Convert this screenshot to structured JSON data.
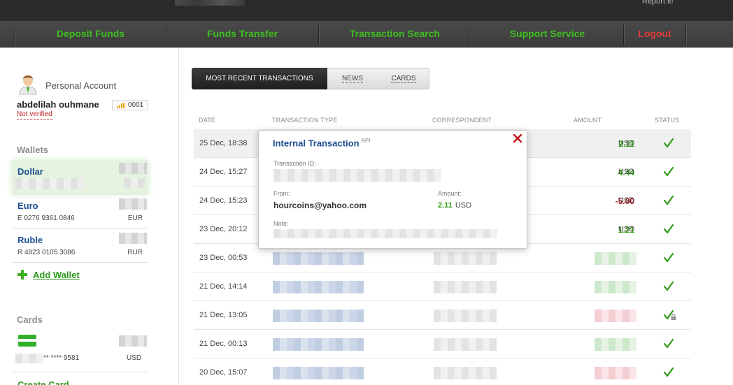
{
  "topbar": {
    "report_link": "Report it!"
  },
  "nav": {
    "items": [
      "Deposit Funds",
      "Funds Transfer",
      "Transaction Search",
      "Support Service"
    ],
    "logout": "Logout"
  },
  "account": {
    "label": "Personal Account",
    "name": "abdelilah ouhmane",
    "badge": "0001",
    "status": "Not verified"
  },
  "wallets": {
    "title": "Wallets",
    "items": [
      {
        "name": "Dollar",
        "number": "",
        "currency": ""
      },
      {
        "name": "Euro",
        "number": "E 0276 9361 0846",
        "currency": "EUR"
      },
      {
        "name": "Ruble",
        "number": "R 4823 0105 3086",
        "currency": "RUR"
      }
    ],
    "add_label": "Add Wallet"
  },
  "cards": {
    "title": "Cards",
    "number": "** **** 9581",
    "currency": "USD",
    "create_label": "Create Card"
  },
  "tabs": [
    "MOST RECENT TRANSACTIONS",
    "NEWS",
    "CARDS"
  ],
  "table": {
    "headers": [
      "DATE",
      "TRANSACTION TYPE",
      "CORRESPONDENT",
      "AMOUNT",
      "STATUS"
    ],
    "rows": [
      {
        "date": "25 Dec, 18:38",
        "amount": "2.11",
        "currency": "USD",
        "sign": "pos"
      },
      {
        "date": "24 Dec, 15:27",
        "amount": "4.44",
        "currency": "USD",
        "sign": "pos"
      },
      {
        "date": "24 Dec, 15:23",
        "amount": "-5.00",
        "currency": "USD",
        "sign": "neg"
      },
      {
        "date": "23 Dec, 20:12",
        "amount": "1.21",
        "currency": "USD",
        "sign": "pos"
      },
      {
        "date": "23 Dec, 00:53",
        "amount": "",
        "currency": "",
        "sign": "pos"
      },
      {
        "date": "21 Dec, 14:14",
        "amount": "",
        "currency": "",
        "sign": "pos"
      },
      {
        "date": "21 Dec, 13:05",
        "amount": "",
        "currency": "",
        "sign": "neg"
      },
      {
        "date": "21 Dec, 00:13",
        "amount": "",
        "currency": "",
        "sign": "pos"
      },
      {
        "date": "20 Dec, 15:07",
        "amount": "",
        "currency": "",
        "sign": "neg"
      }
    ]
  },
  "popup": {
    "title": "Internal Transaction",
    "title_sup": "API",
    "txid_label": "Transaction ID:",
    "from_label": "From:",
    "from_value": "hourcoins@yahoo.com",
    "amount_label": "Amount:",
    "amount_value": "2.11",
    "amount_currency": "USD",
    "note_label": "Note:"
  },
  "colors": {
    "accent_green": "#3fbf21",
    "logout_red": "#e23b3b",
    "link_blue": "#1d4f91",
    "negative": "#b4141c"
  }
}
